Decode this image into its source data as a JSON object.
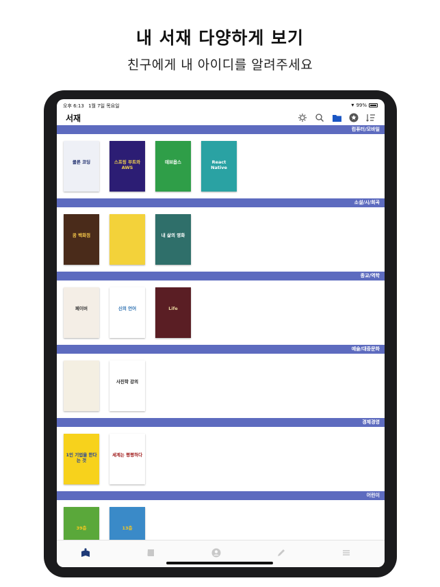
{
  "promo": {
    "headline": "내 서재 다양하게 보기",
    "subline": "친구에게 내 아이디를 알려주세요"
  },
  "status": {
    "time": "오후 6:13",
    "date": "1월 7일 목요일",
    "battery": "99%"
  },
  "nav": {
    "title": "서재",
    "icons": [
      "settings-gear-icon",
      "search-icon",
      "folder-icon",
      "star-badge-icon",
      "sort-list-icon"
    ]
  },
  "colors": {
    "category_bar": "#5d6bbf",
    "active_tab": "#1e3a78",
    "inactive_tab": "#c8c8c8",
    "folder_icon": "#1a56c4"
  },
  "categories": [
    {
      "label": "컴퓨터/모바일",
      "books": [
        {
          "title": "클론 코딩",
          "bg": "#eef0f6",
          "fg": "#1b2a6b"
        },
        {
          "title": "스프링 부트와 AWS",
          "bg": "#2c1d74",
          "fg": "#f0d050"
        },
        {
          "title": "데브옵스",
          "bg": "#2f9e48",
          "fg": "#ffffff"
        },
        {
          "title": "React Native",
          "bg": "#2aa2a3",
          "fg": "#ffffff"
        }
      ]
    },
    {
      "label": "소설/시/희곡",
      "books": [
        {
          "title": "꿈 백화점",
          "bg": "#4a2b1a",
          "fg": "#f5c74a"
        },
        {
          "title": "",
          "bg": "#f3d23a",
          "fg": "#7a4a1a"
        },
        {
          "title": "내 삶의 영화",
          "bg": "#2f6f6a",
          "fg": "#ffffff"
        }
      ]
    },
    {
      "label": "종교/역학",
      "books": [
        {
          "title": "페이버",
          "bg": "#f4eee6",
          "fg": "#333333"
        },
        {
          "title": "신의 언어",
          "bg": "#ffffff",
          "fg": "#2a6fb0"
        },
        {
          "title": "Life",
          "bg": "#5a1e24",
          "fg": "#e9d6a0"
        }
      ]
    },
    {
      "label": "예술/대중문화",
      "books": [
        {
          "title": "",
          "bg": "#f4efe2",
          "fg": "#555555"
        },
        {
          "title": "사진학 강의",
          "bg": "#ffffff",
          "fg": "#222222"
        }
      ]
    },
    {
      "label": "경제경영",
      "books": [
        {
          "title": "1인 기업을 한다는 것",
          "bg": "#f7d21c",
          "fg": "#1a3ea0"
        },
        {
          "title": "세계는 평평하다",
          "bg": "#ffffff",
          "fg": "#a01c1c"
        }
      ]
    },
    {
      "label": "어린이",
      "books": [
        {
          "title": "39층",
          "bg": "#5aa83a",
          "fg": "#f5c820"
        },
        {
          "title": "13층",
          "bg": "#3a8ac8",
          "fg": "#f5c820"
        }
      ]
    }
  ],
  "tabs": [
    "bookshelf-icon",
    "book-icon",
    "profile-icon",
    "pencil-icon",
    "menu-icon"
  ]
}
